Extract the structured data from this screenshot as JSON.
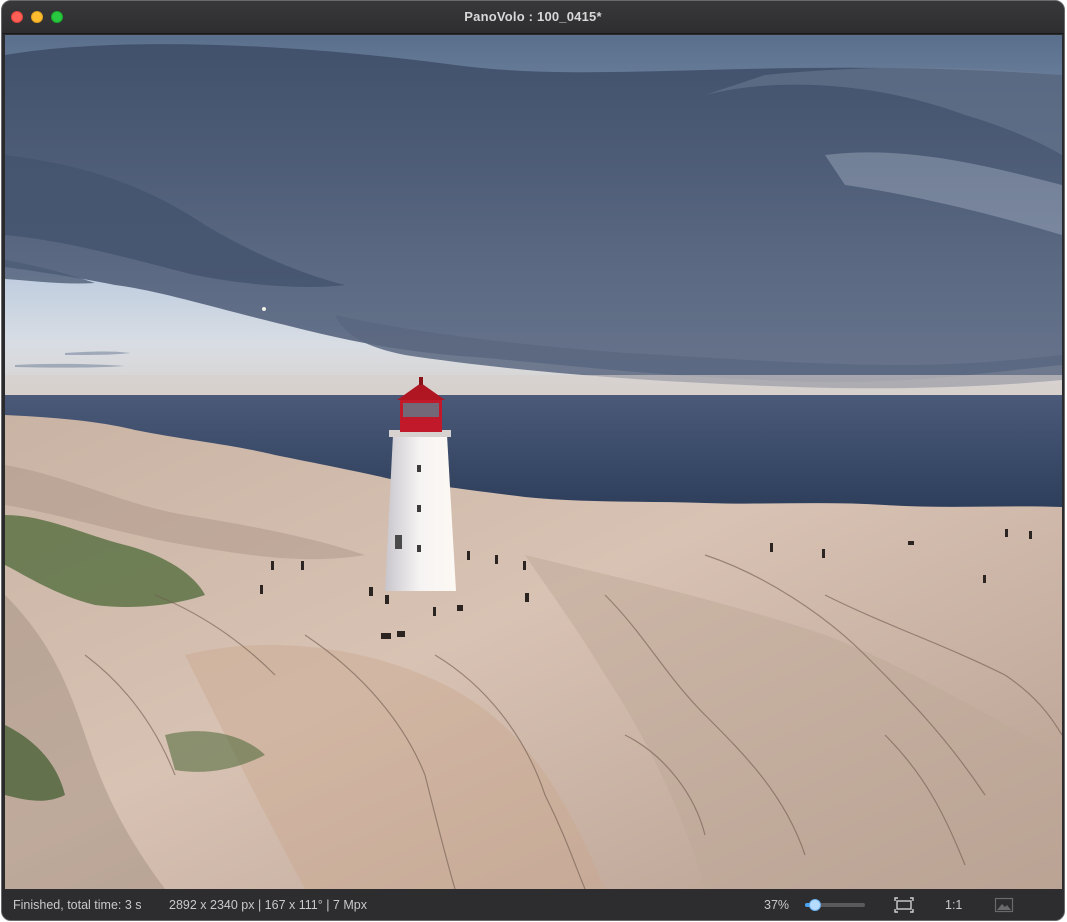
{
  "window": {
    "title": "PanoVolo : 100_0415*"
  },
  "canvas": {
    "description_icon": "photo-canvas"
  },
  "statusbar": {
    "status": "Finished, total time: 3 s",
    "info": "2892 x 2340 px | 167 x 111° | 7 Mpx",
    "zoom_label": "37%",
    "zoom_level": 0.37,
    "one_to_one_label": "1:1",
    "fit_icon": "fit-to-window-icon",
    "image_icon": "image-icon"
  },
  "colors": {
    "accent": "#4aa3f0",
    "titlebar": "#2e2e30",
    "statusbar": "#2d2d2f",
    "close": "#fe5f57",
    "minimize": "#febc2e",
    "maximize": "#28c840"
  }
}
